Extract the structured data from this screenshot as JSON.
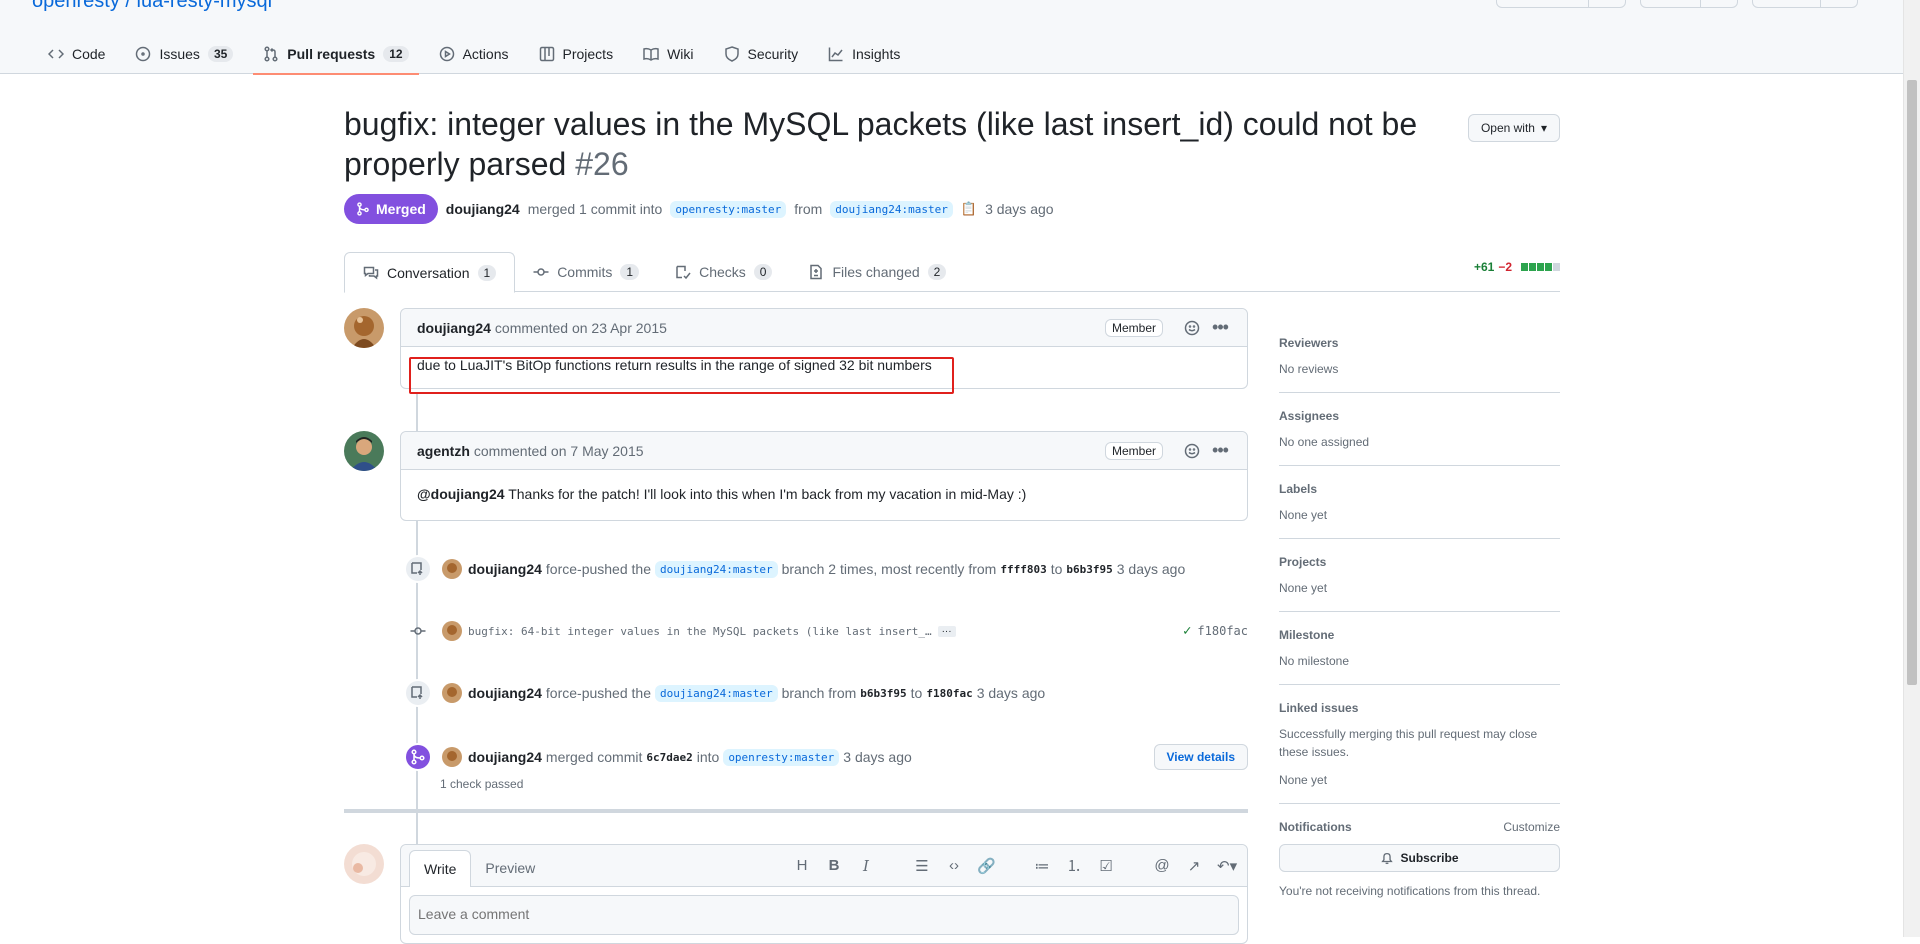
{
  "repo": {
    "name": "openresty / lua-resty-mysql"
  },
  "nav": {
    "tabs": [
      {
        "label": "Code",
        "count": ""
      },
      {
        "label": "Issues",
        "count": "35"
      },
      {
        "label": "Pull requests",
        "count": "12"
      },
      {
        "label": "Actions",
        "count": ""
      },
      {
        "label": "Projects",
        "count": ""
      },
      {
        "label": "Wiki",
        "count": ""
      },
      {
        "label": "Security",
        "count": ""
      },
      {
        "label": "Insights",
        "count": ""
      }
    ]
  },
  "pr": {
    "title": "bugfix: integer values in the MySQL packets (like last insert_id) could not be properly parsed",
    "number": "#26",
    "open_with": "Open with",
    "status": "Merged",
    "author": "doujiang24",
    "merge_text": "merged 1 commit into",
    "base_branch": "openresty:master",
    "from_text": "from",
    "head_branch": "doujiang24:master",
    "time": "3 days ago",
    "tabs": [
      {
        "label": "Conversation",
        "count": "1"
      },
      {
        "label": "Commits",
        "count": "1"
      },
      {
        "label": "Checks",
        "count": "0"
      },
      {
        "label": "Files changed",
        "count": "2"
      }
    ],
    "additions": "+61",
    "deletions": "−2"
  },
  "comments": [
    {
      "author": "doujiang24",
      "meta": "commented on 23 Apr 2015",
      "role": "Member",
      "body": "due to LuaJIT's BitOp functions return results in the range of signed 32 bit numbers"
    },
    {
      "author": "agentzh",
      "meta": "commented on 7 May 2015",
      "role": "Member",
      "mention": "@doujiang24",
      "body": "Thanks for the patch! I'll look into this when I'm back from my vacation in mid-May :)"
    }
  ],
  "events": {
    "push1": {
      "author": "doujiang24",
      "t1": "force-pushed the",
      "branch": "doujiang24:master",
      "t2": "branch 2 times, most recently from",
      "from_sha": "ffff803",
      "t3": "to",
      "to_sha": "b6b3f95",
      "time": "3 days ago"
    },
    "commit": {
      "message": "bugfix: 64-bit integer values in the MySQL packets (like last insert_…",
      "ellipsis": "···",
      "sha": "f180fac"
    },
    "push2": {
      "author": "doujiang24",
      "t1": "force-pushed the",
      "branch": "doujiang24:master",
      "t2": "branch from",
      "from_sha": "b6b3f95",
      "t3": "to",
      "to_sha": "f180fac",
      "time": "3 days ago"
    },
    "merge": {
      "author": "doujiang24",
      "t1": "merged commit",
      "sha": "6c7dae2",
      "t2": "into",
      "branch": "openresty:master",
      "time": "3 days ago",
      "view_details": "View details",
      "checks": "1 check passed"
    }
  },
  "composer": {
    "tab_write": "Write",
    "tab_preview": "Preview",
    "placeholder": "Leave a comment"
  },
  "sidebar": {
    "reviewers_label": "Reviewers",
    "reviewers_value": "No reviews",
    "assignees_label": "Assignees",
    "assignees_value": "No one assigned",
    "labels_label": "Labels",
    "labels_value": "None yet",
    "projects_label": "Projects",
    "projects_value": "None yet",
    "milestone_label": "Milestone",
    "milestone_value": "No milestone",
    "linked_label": "Linked issues",
    "linked_desc": "Successfully merging this pull request may close these issues.",
    "linked_value": "None yet",
    "notifications_label": "Notifications",
    "customize": "Customize",
    "subscribe": "Subscribe",
    "notif_note": "You're not receiving notifications from this thread."
  },
  "colors": {
    "merged": "#8250df",
    "link": "#0969da",
    "highlight": "#e0201c",
    "tab_underline": "#fd8c73"
  }
}
